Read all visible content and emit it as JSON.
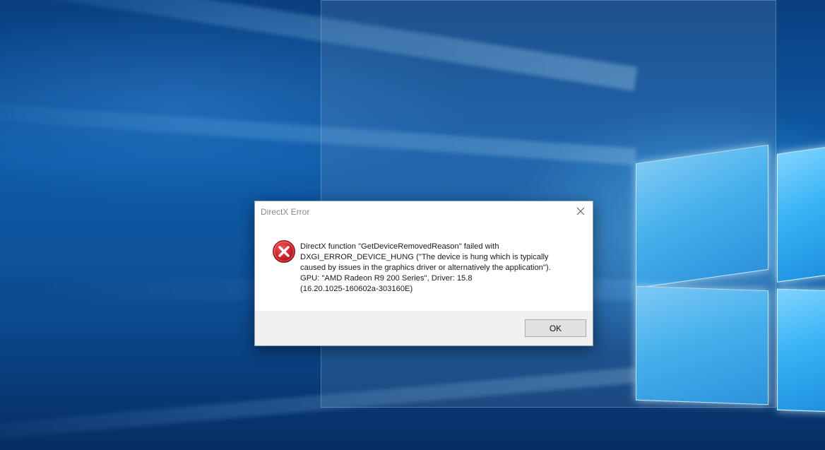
{
  "dialog": {
    "title": "DirectX Error",
    "message_lines": [
      "DirectX function \"GetDeviceRemovedReason\" failed with",
      "DXGI_ERROR_DEVICE_HUNG (\"The device is hung which is typically",
      "caused by issues in the graphics driver or alternatively the application\").",
      "GPU: \"AMD Radeon R9 200 Series\", Driver: 15.8",
      "(16.20.1025-160602a-303160E)"
    ],
    "ok_label": "OK",
    "icon": "error-icon",
    "close_icon": "close-icon"
  },
  "colors": {
    "error_red": "#d0202a",
    "footer_bg": "#f0f0f0",
    "desktop_blue": "#0f5ba8"
  }
}
